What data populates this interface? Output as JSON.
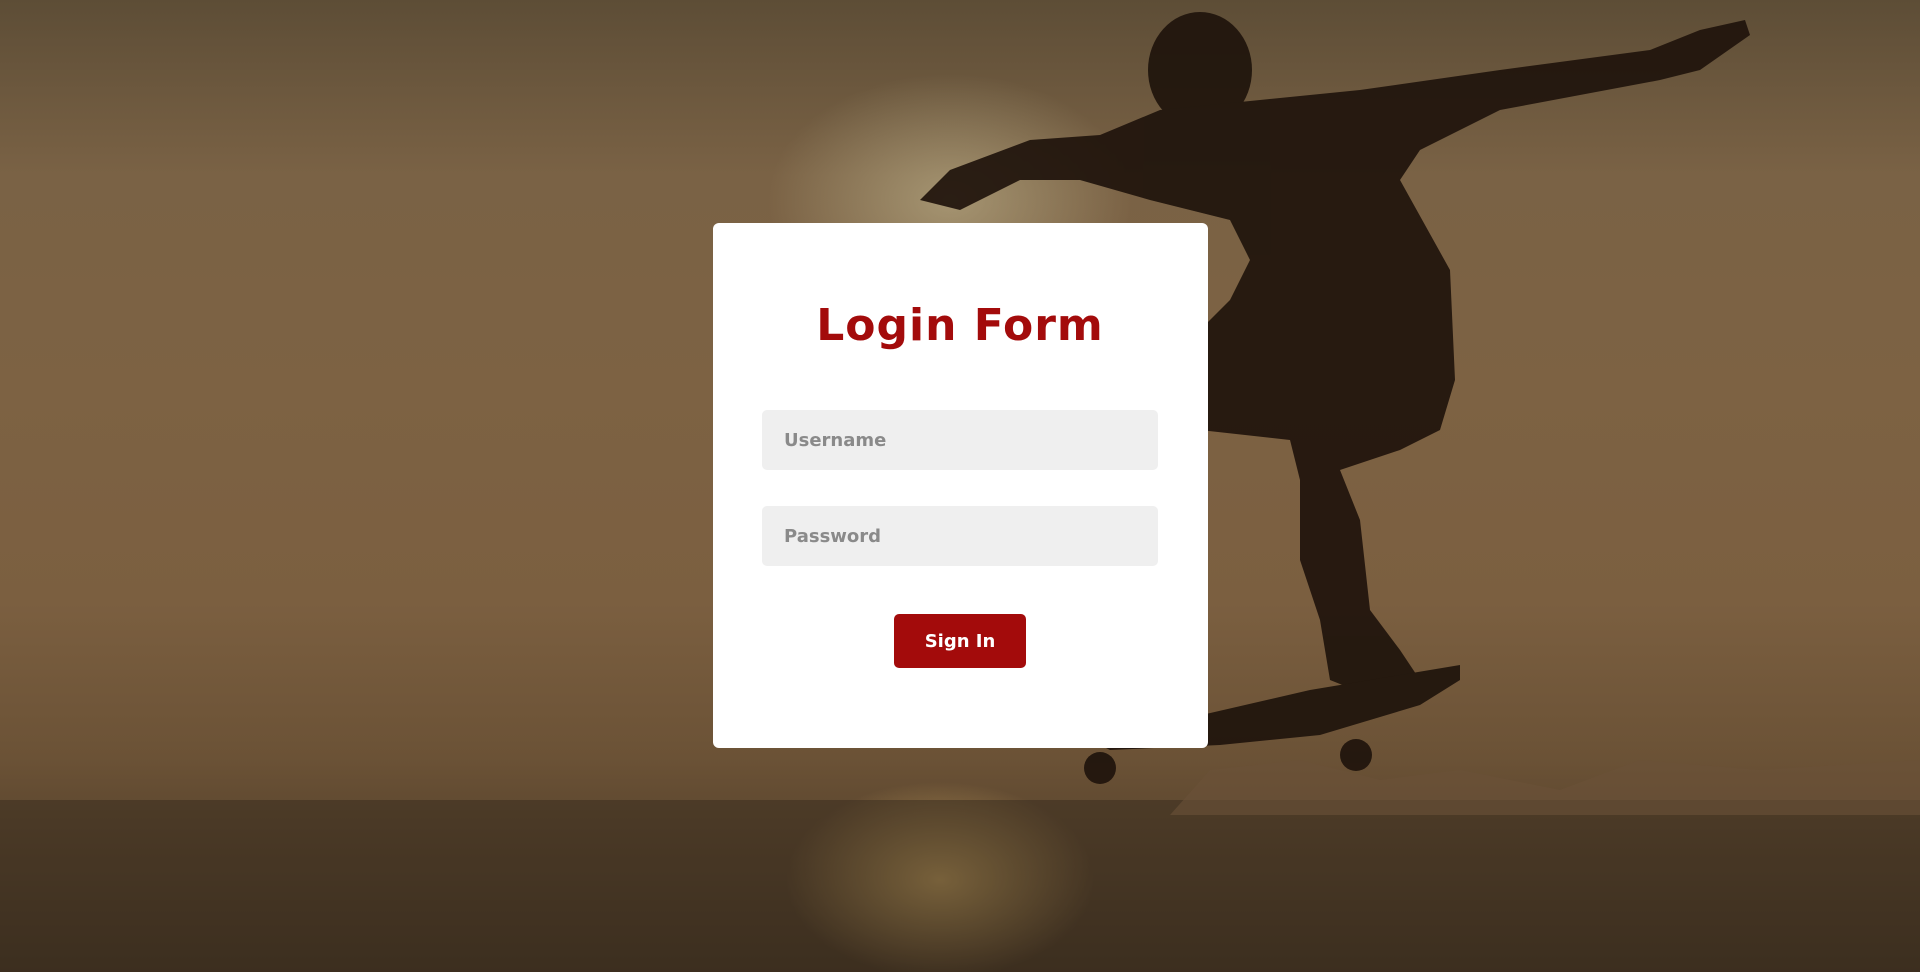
{
  "page": {
    "background_image": "skateboarder-silhouette-sunset-photo"
  },
  "login": {
    "title": "Login Form",
    "username_placeholder": "Username",
    "password_placeholder": "Password",
    "signin_label": "Sign In"
  },
  "colors": {
    "accent": "#a30b0b",
    "card": "#ffffff",
    "input_bg": "#efefef"
  }
}
